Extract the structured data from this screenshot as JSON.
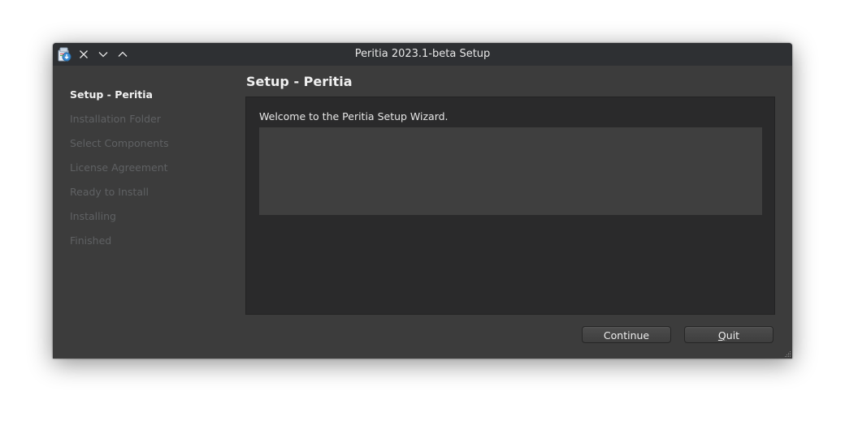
{
  "window": {
    "title": "Peritia 2023.1-beta Setup",
    "titlebar_buttons": [
      {
        "name": "close",
        "icon": "close-icon"
      },
      {
        "name": "minimize",
        "icon": "chevron-down-icon"
      },
      {
        "name": "maximize",
        "icon": "chevron-up-icon"
      }
    ],
    "app_icon": "installer-icon"
  },
  "steps": [
    {
      "label": "Setup - Peritia",
      "active": true
    },
    {
      "label": "Installation Folder",
      "active": false
    },
    {
      "label": "Select Components",
      "active": false
    },
    {
      "label": "License Agreement",
      "active": false
    },
    {
      "label": "Ready to Install",
      "active": false
    },
    {
      "label": "Installing",
      "active": false
    },
    {
      "label": "Finished",
      "active": false
    }
  ],
  "page": {
    "title": "Setup - Peritia",
    "welcome_text": "Welcome to the Peritia Setup Wizard."
  },
  "buttons": {
    "continue_label": "Continue",
    "quit_mnemonic": "Q",
    "quit_rest": "uit"
  },
  "colors": {
    "window_bg": "#3c3c3c",
    "titlebar_bg": "#2e3033",
    "content_bg": "#2a2a2b",
    "inactive_step": "#5f6163",
    "active_step": "#f0f0f0"
  }
}
